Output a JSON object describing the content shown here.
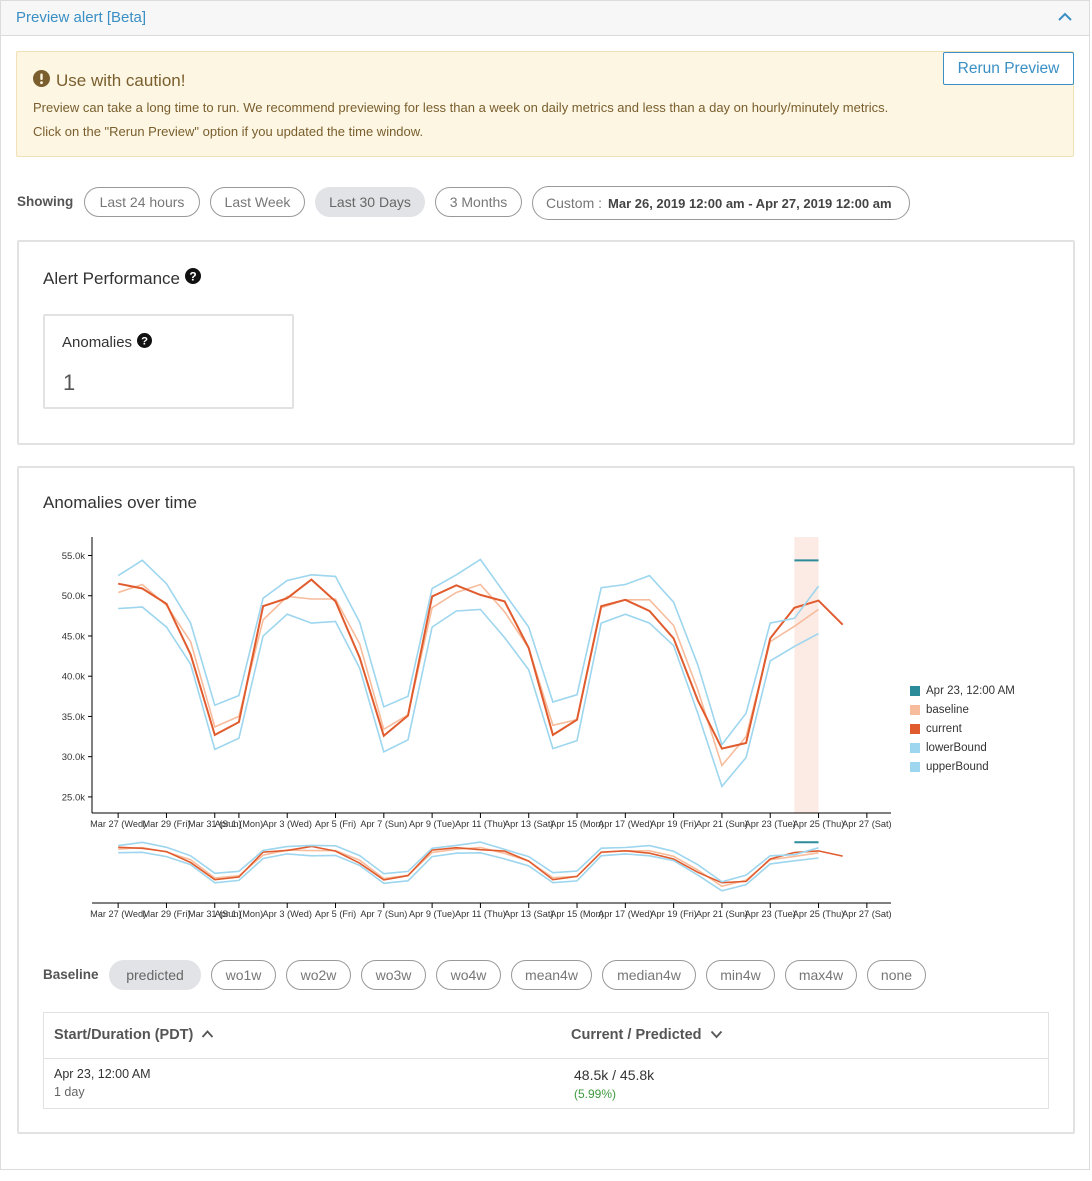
{
  "panel": {
    "title": "Preview alert [Beta]"
  },
  "caution": {
    "title": "Use with caution!",
    "line1": "Preview can take a long time to run. We recommend previewing for less than a week on daily metrics and less than a day on hourly/minutely metrics.",
    "line2": "Click on the \"Rerun Preview\" option if you updated the time window.",
    "rerun_label": "Rerun Preview"
  },
  "range": {
    "showing_label": "Showing",
    "options": [
      "Last 24 hours",
      "Last Week",
      "Last 30 Days",
      "3 Months"
    ],
    "selected": "Last 30 Days",
    "custom_label": "Custom :",
    "custom_value": "Mar 26, 2019 12:00 am - Apr 27, 2019 12:00 am"
  },
  "performance": {
    "title": "Alert Performance",
    "anomalies_label": "Anomalies",
    "anomalies_value": "1"
  },
  "chart_card": {
    "title": "Anomalies over time"
  },
  "chart_data": {
    "type": "line",
    "title": "Anomalies over time",
    "x_tick_labels": [
      "Mar 27 (Wed)",
      "Mar 29 (Fri)",
      "Mar 31 (Sun)",
      "Apr 1 (Mon)",
      "Apr 3 (Wed)",
      "Apr 5 (Fri)",
      "Apr 7 (Sun)",
      "Apr 9 (Tue)",
      "Apr 11 (Thu)",
      "Apr 13 (Sat)",
      "Apr 15 (Mon)",
      "Apr 17 (Wed)",
      "Apr 19 (Fri)",
      "Apr 21 (Sun)",
      "Apr 23 (Tue)",
      "Apr 25 (Thu)",
      "Apr 27 (Sat)"
    ],
    "y_tick_labels": [
      "25.0k",
      "30.0k",
      "35.0k",
      "40.0k",
      "45.0k",
      "50.0k",
      "55.0k"
    ],
    "ylim": [
      23000,
      57300
    ],
    "x_start": "2019-03-26",
    "x_end": "2019-04-28",
    "dates": [
      "Mar 26",
      "Mar 27",
      "Mar 28",
      "Mar 29",
      "Mar 30",
      "Mar 31",
      "Apr 1",
      "Apr 2",
      "Apr 3",
      "Apr 4",
      "Apr 5",
      "Apr 6",
      "Apr 7",
      "Apr 8",
      "Apr 9",
      "Apr 10",
      "Apr 11",
      "Apr 12",
      "Apr 13",
      "Apr 14",
      "Apr 15",
      "Apr 16",
      "Apr 17",
      "Apr 18",
      "Apr 19",
      "Apr 20",
      "Apr 21",
      "Apr 22",
      "Apr 23",
      "Apr 24",
      "Apr 25"
    ],
    "series": [
      {
        "name": "baseline",
        "color": "#f6bc9c",
        "values": [
          50400,
          51400,
          48800,
          44300,
          33700,
          35000,
          47000,
          49900,
          49600,
          49600,
          44000,
          33400,
          35200,
          48500,
          50400,
          51400,
          48000,
          43500,
          33900,
          34600,
          48500,
          49500,
          49500,
          46300,
          38300,
          28900,
          32500,
          44300,
          46200,
          48300,
          null
        ]
      },
      {
        "name": "current",
        "color": "#e05c2e",
        "values": [
          51500,
          50900,
          49000,
          42700,
          32700,
          34300,
          48700,
          49700,
          52000,
          49300,
          42300,
          32600,
          35100,
          49900,
          51300,
          50100,
          49300,
          43500,
          32700,
          34600,
          48700,
          49500,
          48100,
          44700,
          37000,
          31000,
          31700,
          44700,
          48500,
          49400,
          46400
        ]
      },
      {
        "name": "lowerBound",
        "color": "#9dd6ee",
        "values": [
          48400,
          48600,
          46100,
          41500,
          30900,
          32300,
          45000,
          47700,
          46600,
          46800,
          41000,
          30600,
          32100,
          46100,
          48100,
          48300,
          44800,
          40800,
          31000,
          32000,
          46600,
          47700,
          46600,
          43800,
          35400,
          26300,
          29900,
          41900,
          43700,
          45300,
          null
        ]
      },
      {
        "name": "upperBound",
        "color": "#9dd6ee",
        "values": [
          52500,
          54400,
          51500,
          46600,
          36400,
          37600,
          49700,
          51900,
          52600,
          52400,
          46700,
          36200,
          37500,
          50900,
          52600,
          54500,
          50300,
          46100,
          36800,
          37700,
          51000,
          51400,
          52500,
          49200,
          41400,
          31500,
          35400,
          46600,
          47200,
          51200,
          null
        ]
      }
    ],
    "anomaly": {
      "name": "Apr 23, 12:00 AM",
      "color": "#2c8c9a",
      "start": "Apr 23",
      "end": "Apr 24",
      "value": 54400
    }
  },
  "baseline": {
    "label": "Baseline",
    "options": [
      "predicted",
      "wo1w",
      "wo2w",
      "wo3w",
      "wo4w",
      "mean4w",
      "median4w",
      "min4w",
      "max4w",
      "none"
    ],
    "selected": "predicted"
  },
  "table": {
    "col1_header": "Start/Duration (PDT)",
    "col2_header": "Current / Predicted",
    "rows": [
      {
        "start": "Apr 23, 12:00 AM",
        "duration": "1 day",
        "values": "48.5k / 45.8k",
        "change": "(5.99%)"
      }
    ]
  }
}
